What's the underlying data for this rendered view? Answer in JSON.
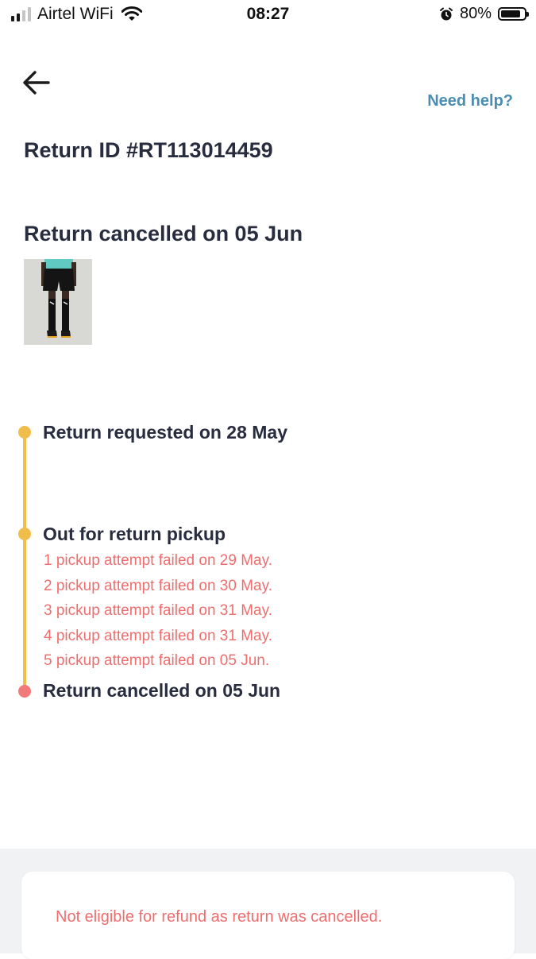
{
  "status_bar": {
    "carrier": "Airtel WiFi",
    "time": "08:27",
    "battery_percent": "80%",
    "signal_bars_active": 2,
    "signal_bars_total": 4,
    "battery_level": 0.8
  },
  "header": {
    "back_icon": "arrow-left-icon",
    "help_label": "Need help?"
  },
  "return": {
    "id_text": "Return ID #RT113014459",
    "status_title": "Return cancelled on 05 Jun"
  },
  "timeline": {
    "steps": [
      {
        "title": "Return requested on 28 May",
        "dot_color": "#f0bd4a"
      },
      {
        "title": "Out for return pickup",
        "dot_color": "#f0bd4a",
        "notes": [
          "1 pickup attempt failed on 29 May.",
          "2 pickup attempt failed on 30 May.",
          "3 pickup attempt failed on 31 May.",
          "4 pickup attempt failed on 31 May.",
          "5 pickup attempt failed on 05 Jun."
        ]
      },
      {
        "title": "Return cancelled on 05 Jun",
        "dot_color": "#f27a7a"
      }
    ]
  },
  "refund": {
    "note": "Not eligible for refund as return was cancelled."
  },
  "colors": {
    "accent_link": "#4a8db0",
    "timeline_yellow": "#f0bd4a",
    "error_red": "#ef6d6d"
  }
}
